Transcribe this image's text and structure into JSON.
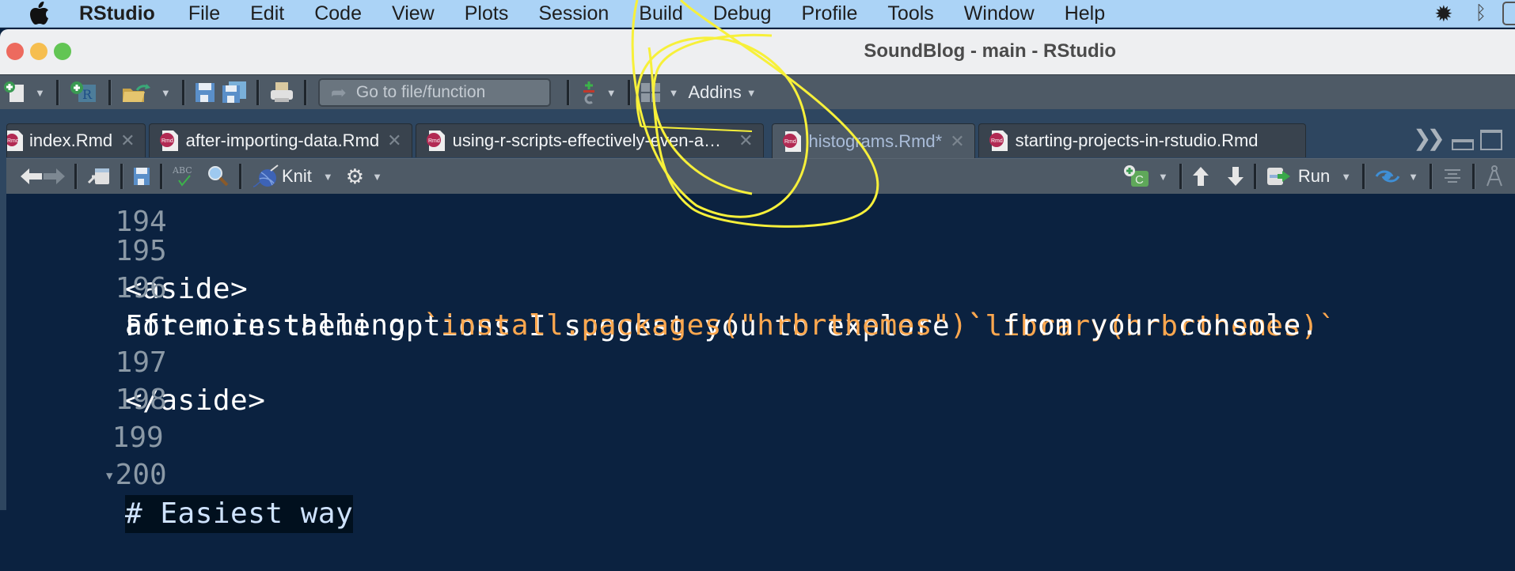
{
  "menubar": {
    "app_name": "RStudio",
    "items": [
      "File",
      "Edit",
      "Code",
      "View",
      "Plots",
      "Session",
      "Build",
      "Debug",
      "Profile",
      "Tools",
      "Window",
      "Help"
    ],
    "status_icons": [
      "brightness-icon",
      "bluetooth-icon"
    ]
  },
  "window": {
    "title": "SoundBlog - main - RStudio"
  },
  "main_toolbar": {
    "goto_placeholder": "Go to file/function",
    "addins_label": "Addins"
  },
  "tabs": [
    {
      "label": "index.Rmd",
      "active": false,
      "modified": false
    },
    {
      "label": "after-importing-data.Rmd",
      "active": false,
      "modified": false
    },
    {
      "label": "using-r-scripts-effectively-even-a…",
      "active": false,
      "modified": false
    },
    {
      "label": "histograms.Rmd*",
      "active": true,
      "modified": true
    },
    {
      "label": "starting-projects-in-rstudio.Rmd",
      "active": false,
      "modified": false
    }
  ],
  "tab_icon_text": "Rmd",
  "source_toolbar": {
    "knit_label": "Knit",
    "run_label": "Run",
    "spell_label": "ABC",
    "chunk_label": "C"
  },
  "editor": {
    "partial_top_line": "194",
    "partial_bottom_line": "200",
    "lines": [
      {
        "num": "195",
        "segments": [
          {
            "text": "<aside>",
            "style": "plain"
          }
        ]
      },
      {
        "num": "196",
        "segments": [
          {
            "text": "For more theme options I suggest you to explore ",
            "style": "plain"
          },
          {
            "text": "`library(hrbrthemes)`",
            "style": "code"
          }
        ]
      },
      {
        "num": "",
        "segments": [
          {
            "text": "after installing ",
            "style": "plain"
          },
          {
            "text": "`install.packages(\"hrbrthemes\")`",
            "style": "code"
          },
          {
            "text": " from your console.",
            "style": "plain"
          }
        ]
      },
      {
        "num": "197",
        "segments": [
          {
            "text": "</aside>",
            "style": "plain"
          }
        ]
      },
      {
        "num": "198",
        "segments": []
      },
      {
        "num": "199",
        "segments": [
          {
            "text": "# Easiest way",
            "style": "heading"
          }
        ],
        "foldable": true
      }
    ]
  },
  "colors": {
    "editor_bg": "#0b2240",
    "code_string": "#ffa84f",
    "annotation": "#f7f03a",
    "menubar_bg": "#abd3f6"
  }
}
